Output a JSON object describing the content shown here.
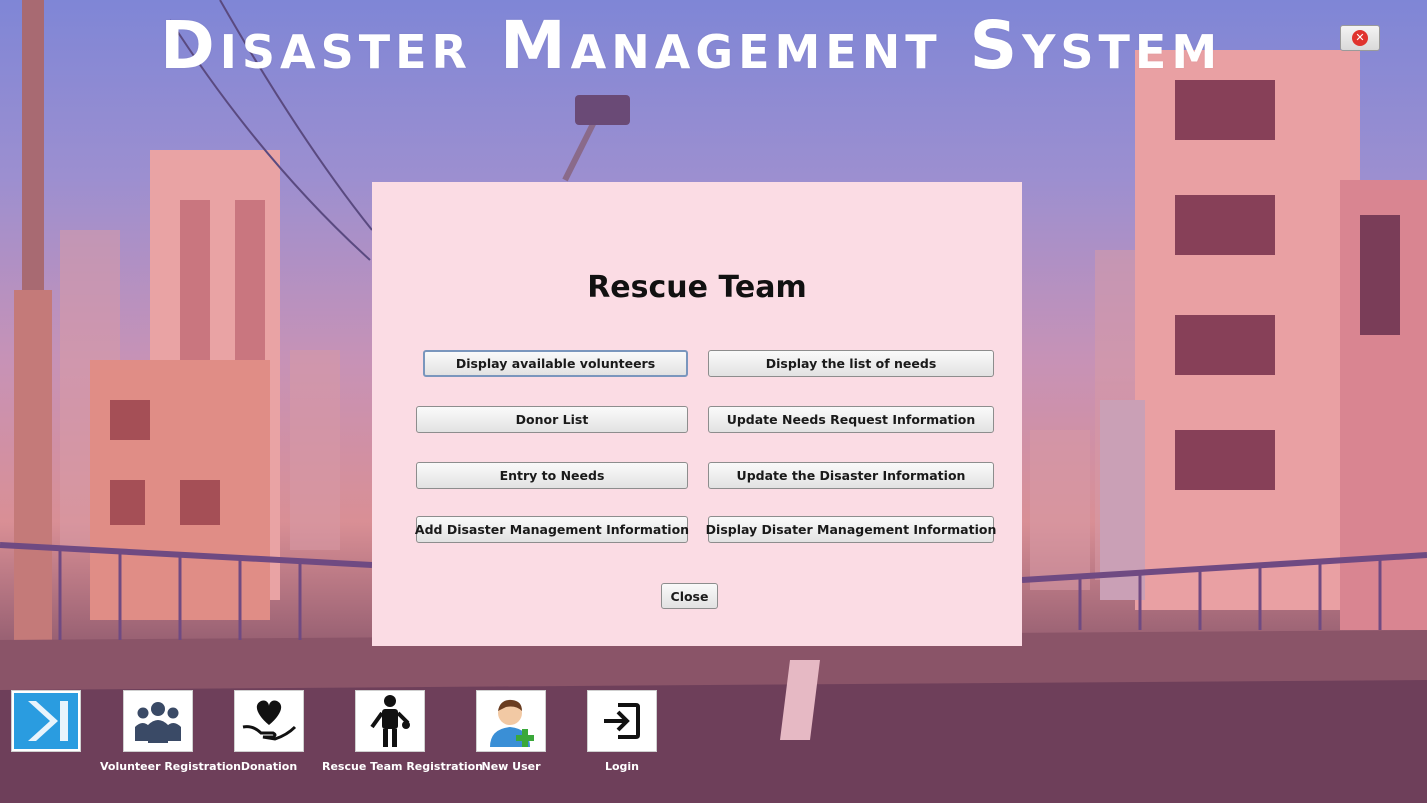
{
  "window": {
    "title": "Disaster Management System",
    "close_icon": "close-circle-icon"
  },
  "panel": {
    "title": "Rescue Team",
    "buttons": {
      "display_volunteers": "Display available volunteers",
      "display_needs": "Display the list of needs",
      "donor_list": "Donor List",
      "update_needs": "Update Needs Request Information",
      "entry_needs": "Entry to Needs",
      "update_disaster": "Update the Disaster Information",
      "add_disaster": "Add Disaster Management Information",
      "display_disaster": "Display Disater Management Information",
      "close": "Close"
    }
  },
  "taskbar": [
    {
      "label": "",
      "icon": "skip-forward-icon"
    },
    {
      "label": "Volunteer Registration",
      "icon": "group-icon"
    },
    {
      "label": "Donation",
      "icon": "heart-hand-icon"
    },
    {
      "label": "Rescue Team Registration",
      "icon": "rescuer-icon"
    },
    {
      "label": "New User",
      "icon": "user-add-icon"
    },
    {
      "label": "Login",
      "icon": "login-icon"
    }
  ],
  "colors": {
    "panel_bg": "#fbdce4",
    "accent_blue": "#4aa8e8",
    "add_green": "#3aa83a"
  }
}
